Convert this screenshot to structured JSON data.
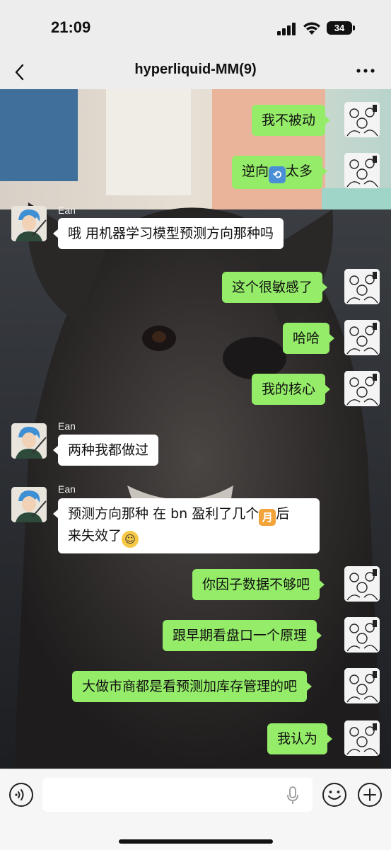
{
  "status": {
    "time": "21:09",
    "battery": "34"
  },
  "nav": {
    "title": "hyperliquid-MM(9)"
  },
  "messages": {
    "m1": "我不被动",
    "m2a": "逆向",
    "m2b": "太多",
    "m3_sender": "Ean",
    "m3": "哦 用机器学习模型预测方向那种吗",
    "m4": "这个很敏感了",
    "m5": "哈哈",
    "m6": "我的核心",
    "m7_sender": "Ean",
    "m7": "两种我都做过",
    "m8_sender": "Ean",
    "m8a": "预测方向那种 在 bn 盈利了几个",
    "m8_moon": "月",
    "m8b": "后",
    "m8c": "来失效了",
    "m9": "你因子数据不够吧",
    "m10": "跟早期看盘口一个原理",
    "m11": "大做市商都是看预测加库存管理的吧",
    "m12": "我认为"
  },
  "colors": {
    "outgoing_bubble": "#95ec69",
    "incoming_bubble": "#ffffff",
    "bar_background": "#ededed"
  }
}
